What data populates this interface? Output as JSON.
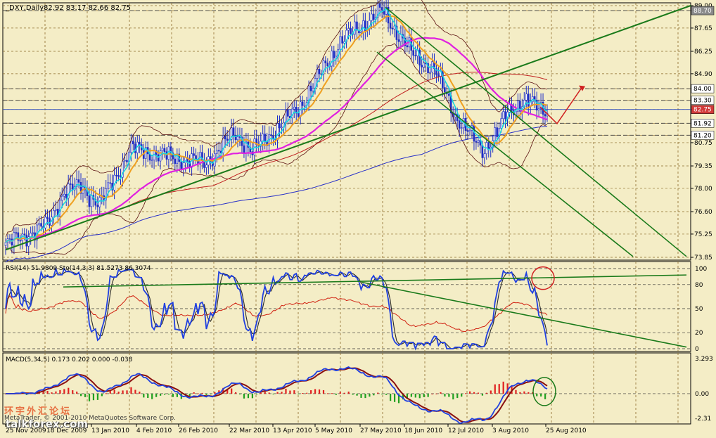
{
  "header": {
    "symbol": "_DXY,Daily",
    "ohlc": "82.92 83.17 82.66 82.75"
  },
  "price_axis": {
    "ticks": [
      "89.00",
      "88.70",
      "87.65",
      "86.25",
      "84.90",
      "84.00",
      "83.30",
      "82.75",
      "81.92",
      "81.20",
      "80.75",
      "79.35",
      "78.00",
      "76.60",
      "75.25",
      "73.85"
    ],
    "marked": [
      {
        "label": "88.70",
        "bg": "#8a8a8a"
      },
      {
        "label": "84.00",
        "bg": "#ffffff"
      },
      {
        "label": "83.30",
        "bg": "#ffffff"
      },
      {
        "label": "82.75",
        "bg": "#d23a3a"
      },
      {
        "label": "81.92",
        "bg": "#ffffff"
      },
      {
        "label": "81.20",
        "bg": "#ffffff"
      }
    ]
  },
  "rsi_panel": {
    "label": "RSI(14) 51.9809  Sto(14,3,3) 81.5273 86.3074",
    "ticks": [
      "100",
      "80",
      "50",
      "20",
      "0"
    ]
  },
  "macd_panel": {
    "label": "MACD(5,34,5) 0.173 0.202 0.000 -0.038",
    "ticks": [
      "3.293",
      "0.00",
      "-2.31"
    ]
  },
  "x_axis": {
    "labels": [
      "25 Nov 2009",
      "18 Dec 2009",
      "13 Jan 2010",
      "4 Feb 2010",
      "26 Feb 2010",
      "22 Mar 2010",
      "13 Apr 2010",
      "5 May 2010",
      "27 May 2010",
      "18 Jun 2010",
      "12 Jul 2010",
      "3 Aug 2010",
      "25 Aug 2010"
    ]
  },
  "watermark": {
    "line1": "环宇外汇论坛",
    "line2": "talkforex.com",
    "copyright": "MetaTrader, © 2001-2010 MetaQuotes Software Corp."
  },
  "colors": {
    "bg": "#f4edc6",
    "candle": "#1c2cc8",
    "ema_fast": "#18d6e0",
    "ema_orange": "#f0a020",
    "ma_magenta": "#e020e0",
    "ma_blue": "#2830c8",
    "ma_red": "#c02020",
    "band": "#5a1010",
    "trend": "#1a7a1a",
    "rsi": "#d02010",
    "stoch": "#2040e0",
    "macd_pos": "#e02020",
    "macd_neg": "#20a020"
  },
  "chart_data": {
    "type": "candlestick",
    "ylim": [
      73.85,
      89.0
    ],
    "x": [
      "2009-11-25",
      "2009-12-18",
      "2010-01-13",
      "2010-02-04",
      "2010-02-26",
      "2010-03-22",
      "2010-04-13",
      "2010-05-05",
      "2010-05-27",
      "2010-06-18",
      "2010-07-12",
      "2010-08-03",
      "2010-08-25"
    ],
    "close": [
      74.6,
      77.9,
      77.0,
      80.4,
      80.3,
      81.1,
      80.9,
      84.2,
      86.8,
      85.9,
      82.9,
      80.6,
      82.75
    ],
    "high": [
      75.0,
      78.2,
      77.6,
      80.8,
      80.7,
      81.5,
      81.3,
      84.9,
      88.7,
      86.3,
      83.5,
      81.0,
      83.3
    ],
    "low": [
      74.2,
      77.2,
      76.5,
      79.6,
      79.7,
      80.4,
      80.3,
      83.0,
      86.1,
      85.2,
      82.2,
      80.2,
      82.5
    ],
    "indicators": {
      "rsi": {
        "name": "RSI(14)",
        "values": [
          55,
          70,
          40,
          65,
          60,
          58,
          50,
          80,
          75,
          40,
          30,
          40,
          52
        ]
      },
      "stoch": {
        "name": "Sto(14,3,3)",
        "values": [
          50,
          95,
          20,
          90,
          85,
          60,
          10,
          95,
          90,
          5,
          10,
          5,
          86
        ]
      },
      "macd": {
        "name": "MACD(5,34,5)",
        "values": [
          0.2,
          0.8,
          0.3,
          1.0,
          0.7,
          0.8,
          0.3,
          2.0,
          1.8,
          0.2,
          -0.9,
          -1.6,
          0.17
        ]
      }
    }
  }
}
